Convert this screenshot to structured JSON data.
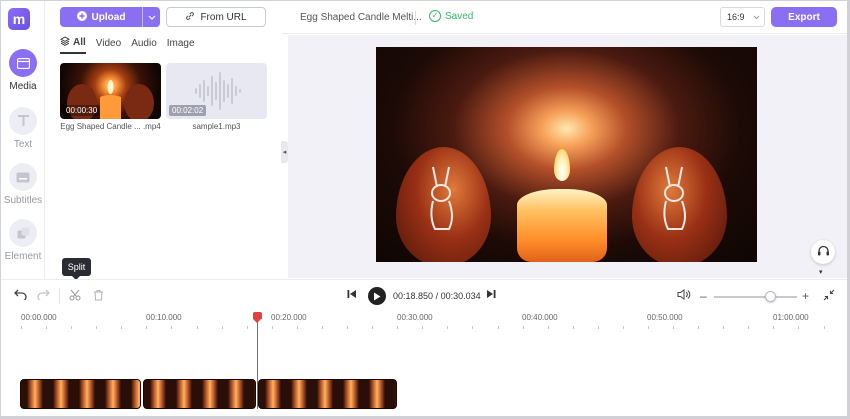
{
  "sidebar": {
    "items": [
      {
        "label": "Media",
        "icon": "media-icon",
        "active": true
      },
      {
        "label": "Text",
        "icon": "text-icon"
      },
      {
        "label": "Subtitles",
        "icon": "subtitles-icon"
      },
      {
        "label": "Element",
        "icon": "element-icon"
      }
    ]
  },
  "media_panel": {
    "upload_label": "Upload",
    "from_url_label": "From URL",
    "filters": [
      "All",
      "Video",
      "Audio",
      "Image"
    ],
    "items": [
      {
        "name": "Egg Shaped Candle ... .mp4",
        "duration": "00:00:30",
        "type": "video"
      },
      {
        "name": "sample1.mp3",
        "duration": "00:02:02",
        "type": "audio"
      }
    ]
  },
  "header": {
    "project_title": "Egg Shaped Candle Melti...",
    "saved_label": "Saved",
    "aspect_ratio": "16:9",
    "export_label": "Export"
  },
  "tooltip": {
    "label": "Split"
  },
  "player": {
    "current_time": "00:18.850",
    "total_time": "00:30.034",
    "zoom_level": 0.68
  },
  "timeline": {
    "ticks": [
      "00:00.000",
      "00:10.000",
      "00:20.000",
      "00:30.000",
      "00:40.000",
      "00:50.000",
      "01:00.000"
    ]
  },
  "colors": {
    "accent": "#8a6ff2",
    "saved": "#3bb46b",
    "playhead": "#e53e3e"
  }
}
